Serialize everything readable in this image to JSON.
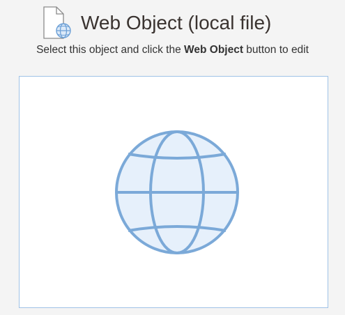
{
  "header": {
    "title": "Web Object (local file)",
    "file_icon": "file-globe-icon"
  },
  "instructions": {
    "prefix": "Select this object and click the ",
    "emphasis": "Web Object",
    "suffix": " button to edit"
  },
  "preview": {
    "icon": "globe-icon",
    "accent_color": "#7ba9d8",
    "fill_color": "#e6f0fb",
    "border_color": "#9fc2e6"
  },
  "colors": {
    "background": "#f4f4f4",
    "title": "#3a3330",
    "text": "#333333"
  }
}
